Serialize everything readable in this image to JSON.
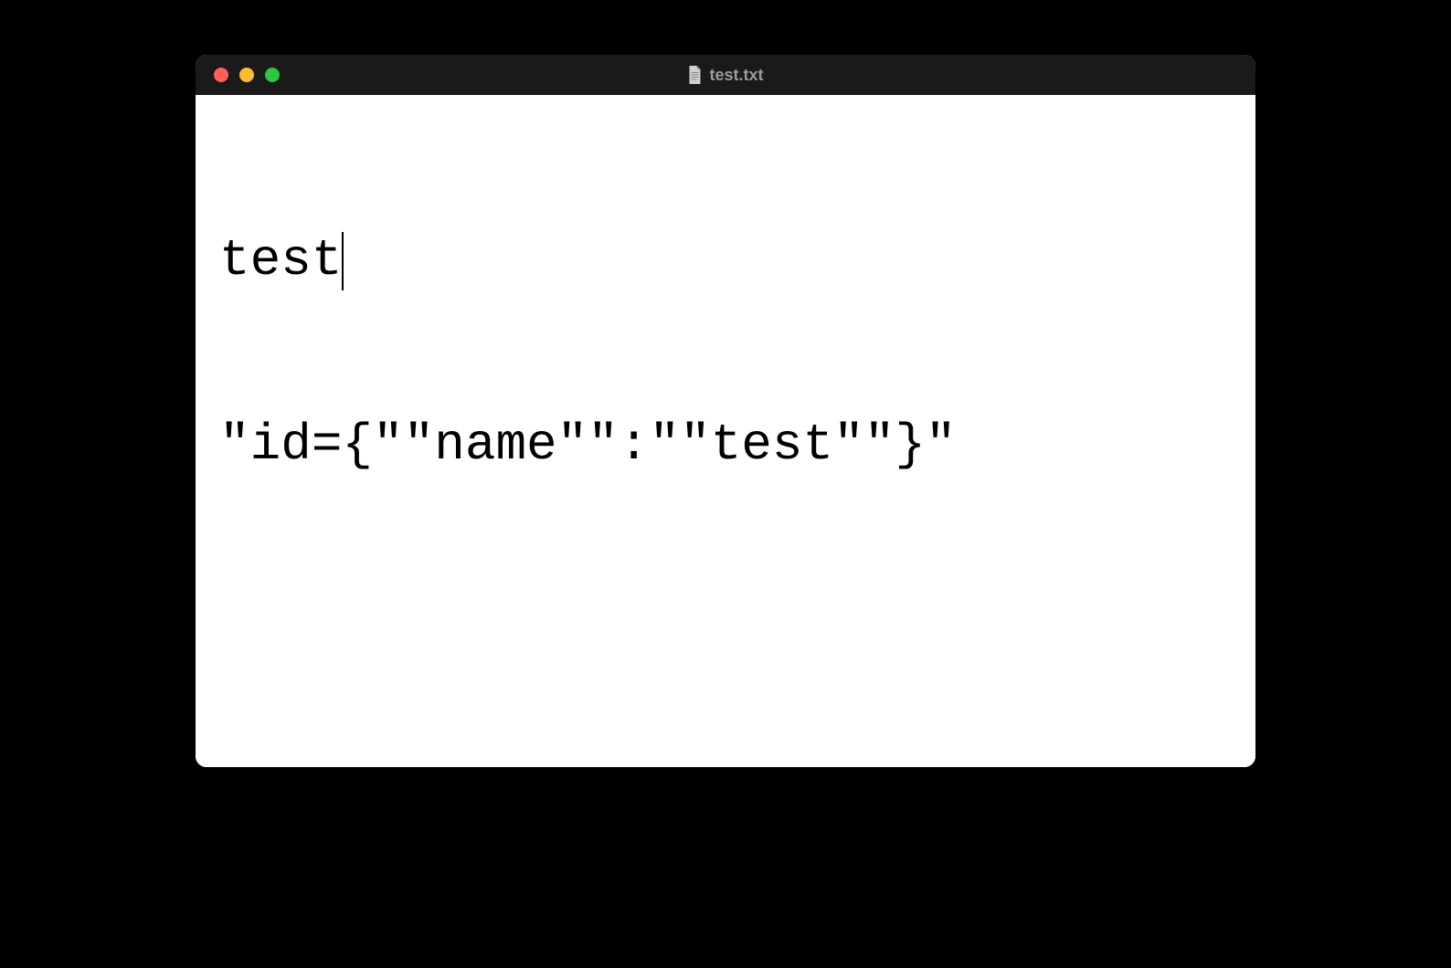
{
  "window": {
    "title": "test.txt",
    "traffic_lights": {
      "close_color": "#ff5f57",
      "minimize_color": "#febc2e",
      "maximize_color": "#28c840"
    }
  },
  "content": {
    "line1": "test",
    "line2": "\"id={\"\"name\"\":\"\"test\"\"}\""
  }
}
